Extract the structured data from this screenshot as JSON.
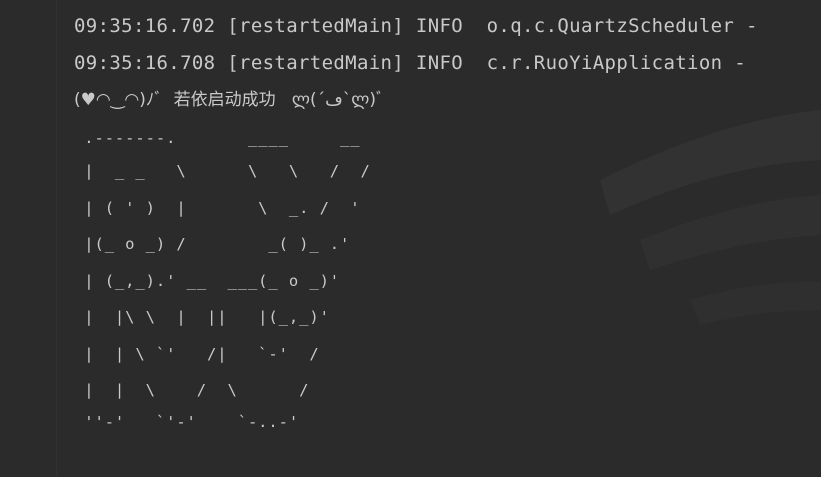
{
  "log_lines": [
    {
      "timestamp": "09:35:16.702",
      "thread": "[restartedMain]",
      "level": "INFO",
      "logger": "o.q.c.QuartzScheduler",
      "tail": "-"
    },
    {
      "timestamp": "09:35:16.708",
      "thread": "[restartedMain]",
      "level": "INFO",
      "logger": "c.r.RuoYiApplication",
      "tail": "-"
    }
  ],
  "startup_message": "(♥◠‿◠)ﾉﾞ  若依启动成功   ლ(´ڡ`ლ)ﾞ",
  "ascii_art": [
    " .-------.       ____     __",
    " |  _ _   \\      \\   \\   /  /",
    " | ( ' )  |       \\  _. /  '",
    " |(_ o _) /        _( )_ .'",
    " | (_,_).' __  ___(_ o _)'",
    " |  |\\ \\  |  ||   |(_,_)'",
    " |  | \\ `'   /|   `-'  /",
    " |  |  \\    /  \\      /",
    " ''-'   `'-'    `-..-'"
  ],
  "colors": {
    "background": "#2b2b2b",
    "text": "#c9c9c9",
    "gutter_border": "#323232"
  }
}
